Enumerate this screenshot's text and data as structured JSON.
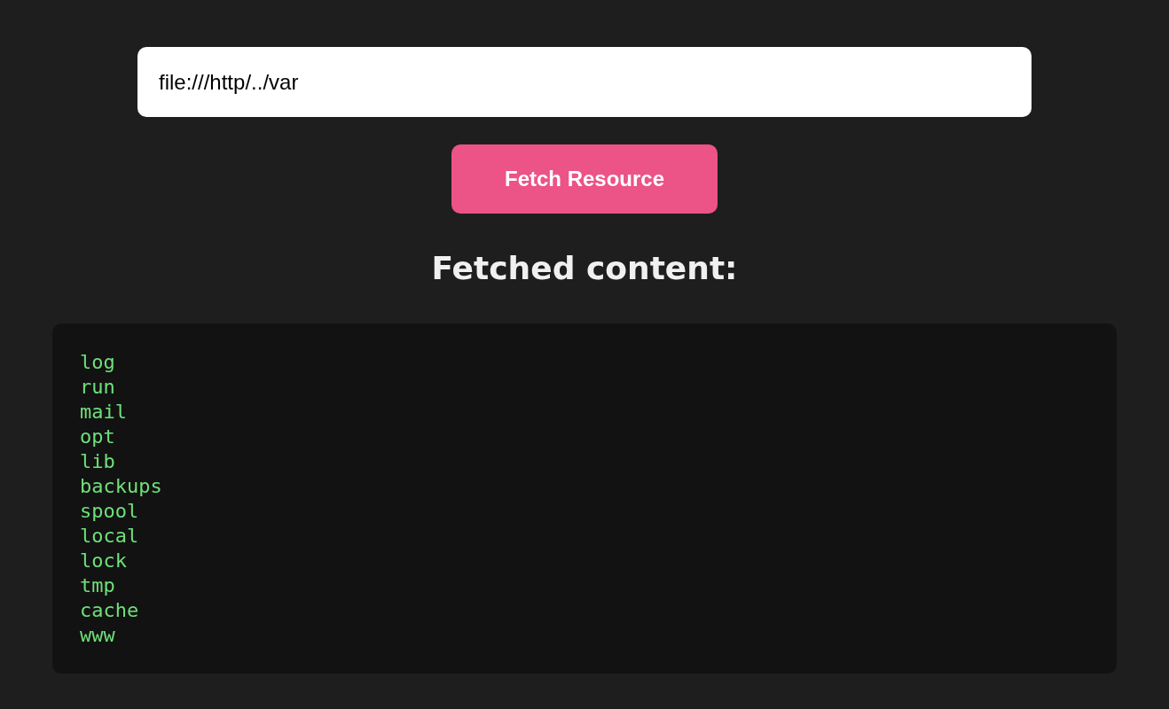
{
  "url_field": {
    "value": "file:///http/../var"
  },
  "fetch_button": {
    "label": "Fetch Resource"
  },
  "result": {
    "heading": "Fetched content:",
    "lines": [
      "log",
      "run",
      "mail",
      "opt",
      "lib",
      "backups",
      "spool",
      "local",
      "lock",
      "tmp",
      "cache",
      "www"
    ]
  }
}
